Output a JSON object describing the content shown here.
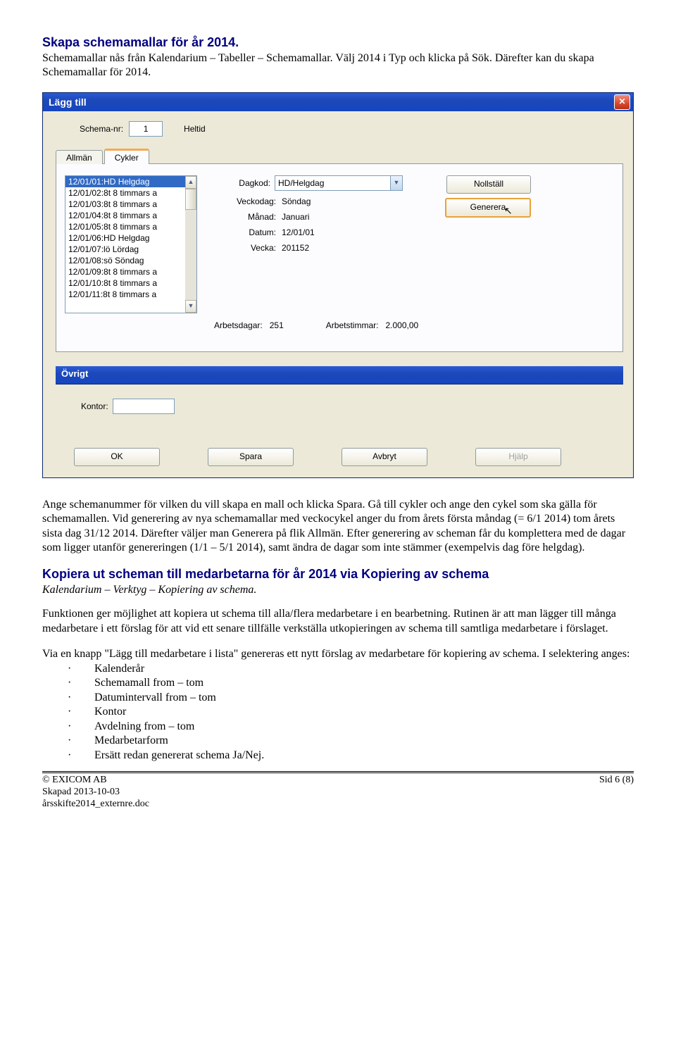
{
  "heading1": "Skapa schemamallar för år 2014.",
  "intro": "Schemamallar nås från Kalendarium – Tabeller – Schemamallar. Välj 2014 i Typ och klicka på Sök. Därefter kan du skapa Schemamallar för 2014.",
  "dialog": {
    "title": "Lägg till",
    "schema_nr_label": "Schema-nr:",
    "schema_nr_value": "1",
    "heltid_label": "Heltid",
    "tab_allman": "Allmän",
    "tab_cykler": "Cykler",
    "list": [
      "12/01/01:HD Helgdag",
      "12/01/02:8t 8 timmars a",
      "12/01/03:8t 8 timmars a",
      "12/01/04:8t 8 timmars a",
      "12/01/05:8t 8 timmars a",
      "12/01/06:HD Helgdag",
      "12/01/07:lö Lördag",
      "12/01/08:sö Söndag",
      "12/01/09:8t 8 timmars a",
      "12/01/10:8t 8 timmars a",
      "12/01/11:8t 8 timmars a"
    ],
    "fields": {
      "dagkod_l": "Dagkod:",
      "dagkod_v": "HD/Helgdag",
      "veckodag_l": "Veckodag:",
      "veckodag_v": "Söndag",
      "manad_l": "Månad:",
      "manad_v": "Januari",
      "datum_l": "Datum:",
      "datum_v": "12/01/01",
      "vecka_l": "Vecka:",
      "vecka_v": "201152",
      "arbetsdagar_l": "Arbetsdagar:",
      "arbetsdagar_v": "251",
      "arbetstimmar_l": "Arbetstimmar:",
      "arbetstimmar_v": "2.000,00"
    },
    "btn_nollstall": "Nollställ",
    "btn_generera": "Generera",
    "ovrigt": "Övrigt",
    "kontor_l": "Kontor:",
    "kontor_v": "",
    "btn_ok": "OK",
    "btn_spara": "Spara",
    "btn_avbryt": "Avbryt",
    "btn_hjalp": "Hjälp"
  },
  "para_after_dialog": "Ange schemanummer för vilken du vill skapa en mall och klicka Spara. Gå till cykler och ange den cykel som ska gälla för schemamallen. Vid generering av nya schemamallar med veckocykel anger du from årets första måndag (= 6/1 2014) tom årets sista dag 31/12 2014. Därefter väljer man Generera på flik Allmän. Efter generering av scheman får du komplettera med de dagar som ligger utanför genereringen (1/1 – 5/1 2014), samt ändra de dagar som inte stämmer (exempelvis dag före helgdag).",
  "heading2": "Kopiera ut scheman till medarbetarna för år 2014 via Kopiering av schema",
  "subpath": "Kalendarium – Verktyg – Kopiering av schema.",
  "para2": " Funktionen ger möjlighet att kopiera ut schema till alla/flera medarbetare i en bearbetning. Rutinen är att man lägger till många medarbetare i ett förslag för att vid ett senare tillfälle verkställa utkopieringen av schema till samtliga medarbetare i förslaget.",
  "para3": "Via en knapp \"Lägg till medarbetare i lista\" genereras ett nytt förslag av medarbetare för kopiering av schema. I selektering anges:",
  "selectors": [
    "Kalenderår",
    "Schemamall from – tom",
    "Datumintervall from – tom",
    "Kontor",
    "Avdelning from – tom",
    "Medarbetarform",
    "Ersätt redan genererat schema Ja/Nej."
  ],
  "footer": {
    "copyright": "© EXICOM AB",
    "created": "Skapad 2013-10-03",
    "file": "årsskifte2014_externre.doc",
    "page": "Sid 6 (8)"
  }
}
